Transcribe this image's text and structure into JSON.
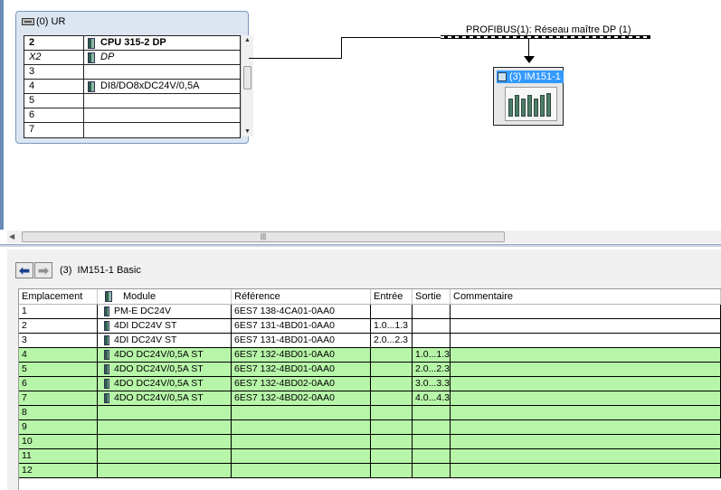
{
  "station": {
    "rack": {
      "title": "(0) UR",
      "rows": [
        {
          "slot": "2",
          "module": "CPU 315-2 DP",
          "icon": "cpu-module-icon",
          "style": "bold"
        },
        {
          "slot": "X2",
          "module": "DP",
          "icon": "dp-interface-icon",
          "style": "italic"
        },
        {
          "slot": "3",
          "module": "",
          "icon": "",
          "style": ""
        },
        {
          "slot": "4",
          "module": "DI8/DO8xDC24V/0,5A",
          "icon": "io-module-icon",
          "style": ""
        },
        {
          "slot": "5",
          "module": "",
          "icon": "",
          "style": ""
        },
        {
          "slot": "6",
          "module": "",
          "icon": "",
          "style": ""
        },
        {
          "slot": "7",
          "module": "",
          "icon": "",
          "style": ""
        }
      ]
    },
    "bus_label": "PROFIBUS(1): Réseau maître DP (1)",
    "slave_label": "(3) IM151-1",
    "scroll_grip": "|||"
  },
  "detail": {
    "title": "(3)  IM151-1 Basic",
    "columns": {
      "slot": "Emplacement",
      "module": "Module",
      "reference": "Référence",
      "input": "Entrée",
      "output": "Sortie",
      "comment": "Commentaire"
    },
    "rows": [
      {
        "slot": "1",
        "module": "PM-E DC24V",
        "reference": "6ES7 138-4CA01-0AA0",
        "input": "",
        "output": "",
        "comment": "",
        "highlight": false
      },
      {
        "slot": "2",
        "module": "4DI DC24V ST",
        "reference": "6ES7 131-4BD01-0AA0",
        "input": "1.0...1.3",
        "output": "",
        "comment": "",
        "highlight": false
      },
      {
        "slot": "3",
        "module": "4DI DC24V ST",
        "reference": "6ES7 131-4BD01-0AA0",
        "input": "2.0...2.3",
        "output": "",
        "comment": "",
        "highlight": false
      },
      {
        "slot": "4",
        "module": "4DO DC24V/0,5A ST",
        "reference": "6ES7 132-4BD01-0AA0",
        "input": "",
        "output": "1.0...1.3",
        "comment": "",
        "highlight": true
      },
      {
        "slot": "5",
        "module": "4DO DC24V/0,5A ST",
        "reference": "6ES7 132-4BD01-0AA0",
        "input": "",
        "output": "2.0...2.3",
        "comment": "",
        "highlight": true
      },
      {
        "slot": "6",
        "module": "4DO DC24V/0,5A ST",
        "reference": "6ES7 132-4BD02-0AA0",
        "input": "",
        "output": "3.0...3.3",
        "comment": "",
        "highlight": true
      },
      {
        "slot": "7",
        "module": "4DO DC24V/0,5A ST",
        "reference": "6ES7 132-4BD02-0AA0",
        "input": "",
        "output": "4.0...4.3",
        "comment": "",
        "highlight": true
      },
      {
        "slot": "8",
        "module": "",
        "reference": "",
        "input": "",
        "output": "",
        "comment": "",
        "highlight": true
      },
      {
        "slot": "9",
        "module": "",
        "reference": "",
        "input": "",
        "output": "",
        "comment": "",
        "highlight": true
      },
      {
        "slot": "10",
        "module": "",
        "reference": "",
        "input": "",
        "output": "",
        "comment": "",
        "highlight": true
      },
      {
        "slot": "11",
        "module": "",
        "reference": "",
        "input": "",
        "output": "",
        "comment": "",
        "highlight": true
      },
      {
        "slot": "12",
        "module": "",
        "reference": "",
        "input": "",
        "output": "",
        "comment": "",
        "highlight": true
      }
    ]
  },
  "colors": {
    "highlight_row": "#b7f5a8",
    "selection": "#3399ff",
    "rack_background": "#dce6f1"
  }
}
